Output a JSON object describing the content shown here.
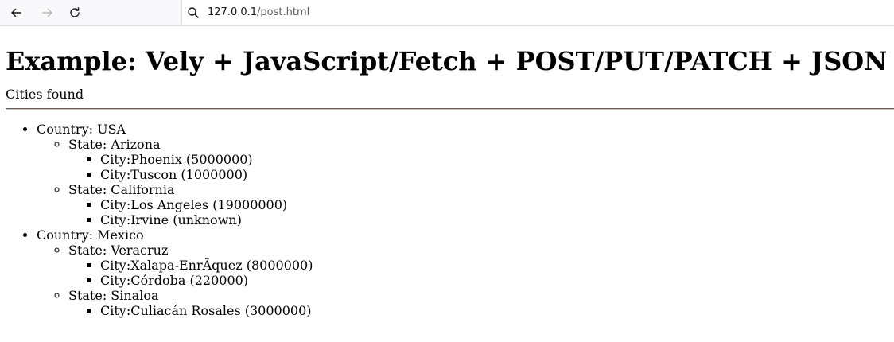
{
  "browser": {
    "url_host": "127.0.0.1",
    "url_path": "/post.html"
  },
  "page": {
    "title": "Example: Vely + JavaScript/Fetch + POST/PUT/PATCH + JSON",
    "subtitle": "Cities found"
  },
  "countries": [
    {
      "label": "Country: USA",
      "states": [
        {
          "label": "State: Arizona",
          "cities": [
            "City:Phoenix (5000000)",
            "City:Tuscon (1000000)"
          ]
        },
        {
          "label": "State: California",
          "cities": [
            "City:Los Angeles (19000000)",
            "City:Irvine (unknown)"
          ]
        }
      ]
    },
    {
      "label": "Country: Mexico",
      "states": [
        {
          "label": "State: Veracruz",
          "cities": [
            "City:Xalapa-EnrÃ­quez (8000000)",
            "City:Córdoba (220000)"
          ]
        },
        {
          "label": "State: Sinaloa",
          "cities": [
            "City:Culiacán Rosales (3000000)"
          ]
        }
      ]
    }
  ]
}
